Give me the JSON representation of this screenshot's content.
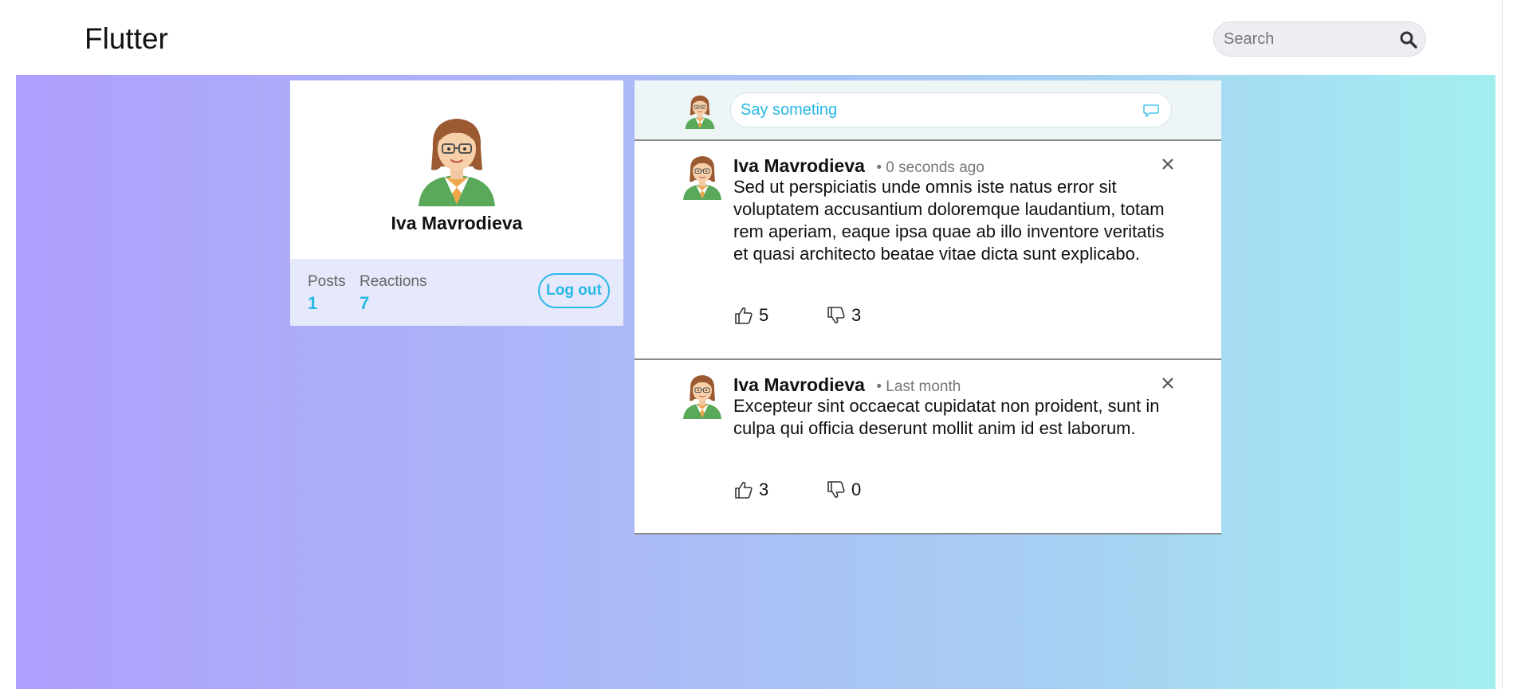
{
  "app": {
    "title": "Flutter"
  },
  "search": {
    "placeholder": "Search",
    "icon": "search-icon"
  },
  "profile": {
    "name": "Iva Mavrodieva",
    "stats": [
      {
        "label": "Posts",
        "value": "1"
      },
      {
        "label": "Reactions",
        "value": "7"
      }
    ],
    "logout_label": "Log out"
  },
  "composer": {
    "placeholder": "Say someting",
    "icon": "comment-icon"
  },
  "posts": [
    {
      "author": "Iva Mavrodieva",
      "time": "• 0 seconds ago",
      "body": "Sed ut perspiciatis unde omnis iste natus error sit voluptatem accusantium doloremque laudantium, totam rem aperiam, eaque ipsa quae ab illo inventore veritatis et quasi architecto beatae vitae dicta sunt explicabo.",
      "likes": "5",
      "dislikes": "3"
    },
    {
      "author": "Iva Mavrodieva",
      "time": "• Last month",
      "body": "Excepteur sint occaecat cupidatat non proident, sunt in culpa qui officia deserunt mollit anim id est laborum.",
      "likes": "3",
      "dislikes": "0"
    }
  ],
  "colors": {
    "accent": "#27b8e6",
    "gradient_start": "#ae9ffc",
    "gradient_end": "#a3eef0",
    "stats_bg": "#e6e8fb",
    "composer_bg": "#eef5f7"
  }
}
